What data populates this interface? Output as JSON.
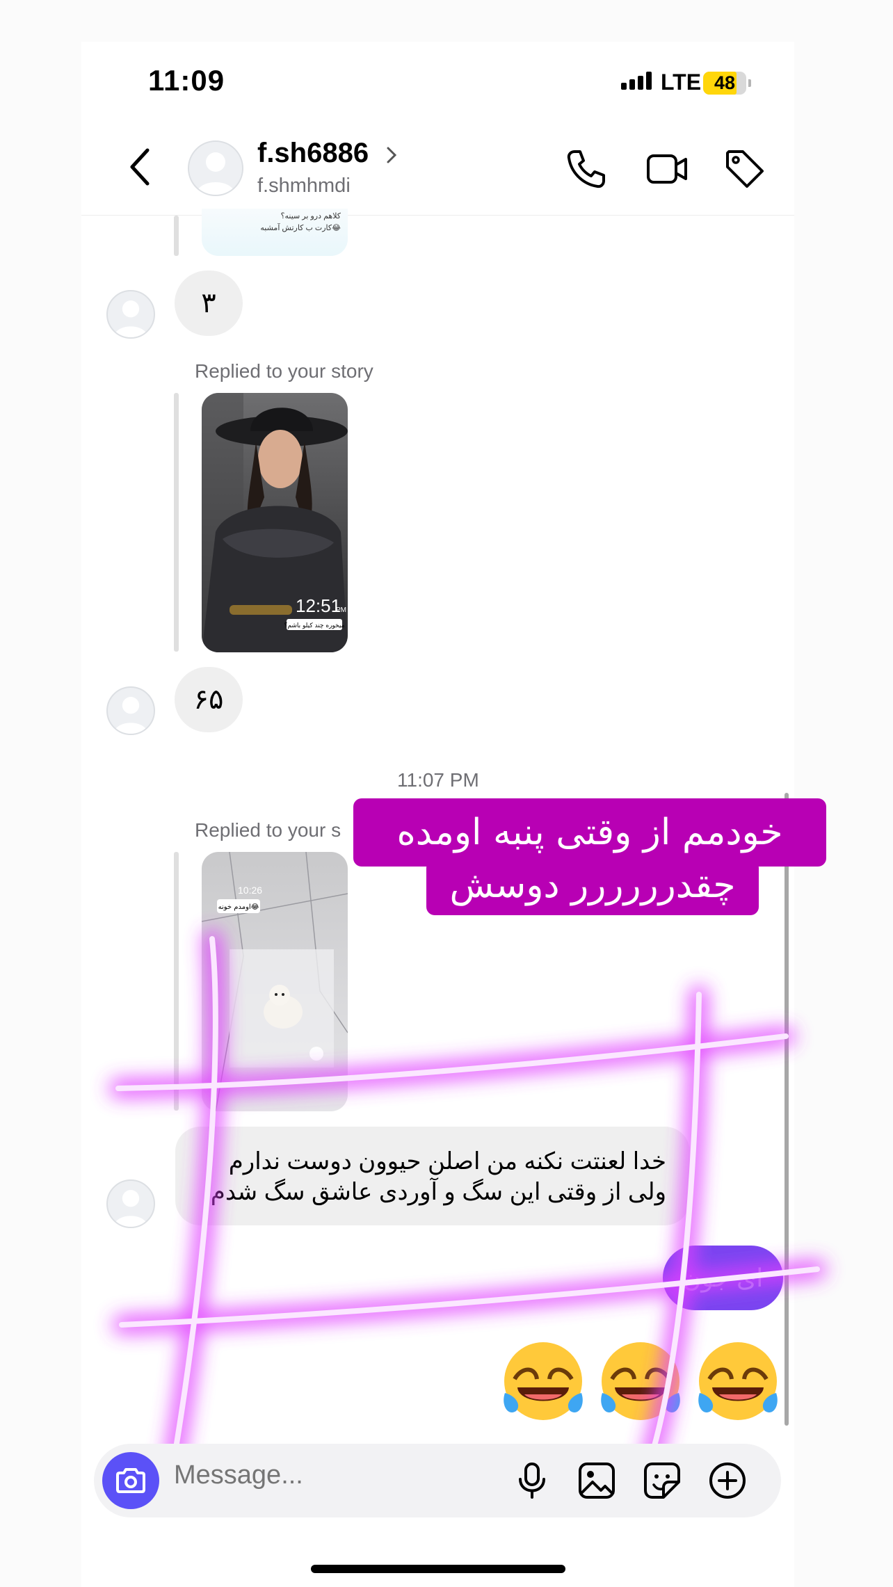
{
  "status": {
    "time": "11:09",
    "network": "LTE",
    "battery": "48"
  },
  "header": {
    "username": "f.sh6886",
    "handle": "f.shmhmdi"
  },
  "thread": {
    "story_caption_lines": [
      "کلاهم درو بر سینه؟",
      "کارت ب کارتش آمشبه😂"
    ],
    "msg1": "٣",
    "replied1": "Replied to your story",
    "story2_time": "12:51",
    "story2_caption": "میخوره چند کیلو باشم؟",
    "msg2": "۶۵",
    "timestamp": "11:07 PM",
    "replied2": "Replied to your s",
    "story3_time": "10:26",
    "story3_caption": "اومدم خونه😂",
    "long_message_line1": "خدا لعنتت نکنه من اصلن حیوون دوست ندارم",
    "long_message_line2": "ولی از وقتی  این سگ و آوردی عاشق سگ شدم",
    "my_message": "ای جون",
    "emojis": "😂😂😂"
  },
  "overlay_text": {
    "line1": "خودمم از وقتی پنبه اومده فهمیدم",
    "line2": "چقدرررررر دوسش دارم"
  },
  "composer": {
    "placeholder": "Message..."
  },
  "colors": {
    "accent": "#5b51f7",
    "my_bubble": "#7a45f0",
    "overlay_bg": "#b800b4",
    "neon": "#e040ff"
  }
}
